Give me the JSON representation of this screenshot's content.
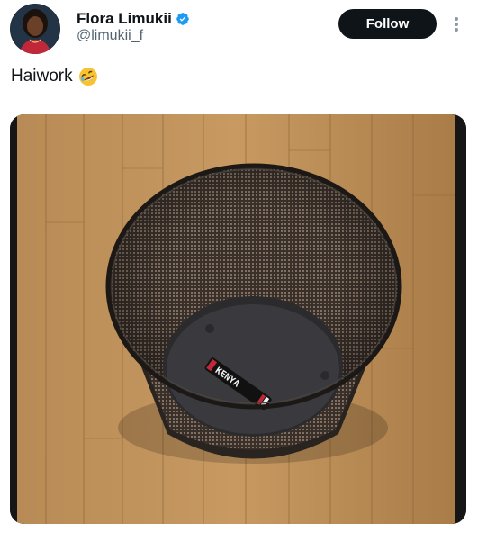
{
  "tweet": {
    "author": {
      "display_name": "Flora Limukii",
      "handle": "@limukii_f",
      "verified": true,
      "verified_color": "#1d9bf0"
    },
    "follow_label": "Follow",
    "text": "Haiwork",
    "emoji": "rolling-on-the-floor-laughing",
    "media": {
      "type": "photo",
      "object": "wastebasket",
      "label_on_object": "KENYA"
    }
  },
  "colors": {
    "text_primary": "#0f1419",
    "text_secondary": "#536471",
    "follow_bg": "#0f1419",
    "follow_text": "#ffffff"
  }
}
